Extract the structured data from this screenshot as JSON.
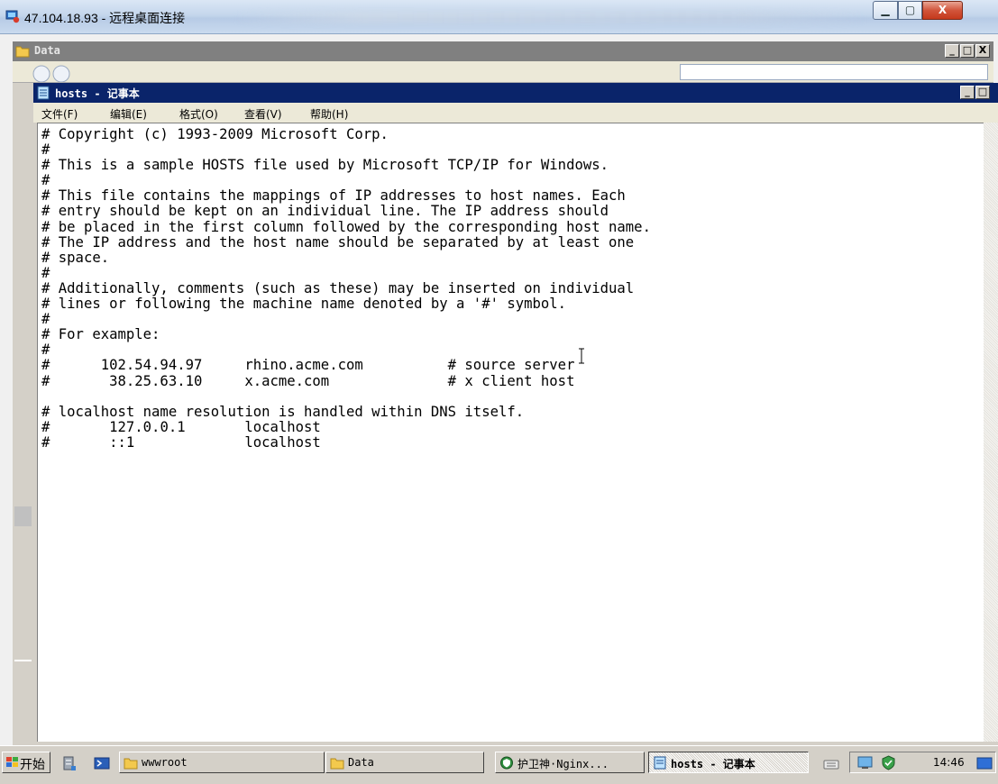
{
  "rdp": {
    "title": "47.104.18.93 - 远程桌面连接",
    "min_label": "▁",
    "max_label": "▢",
    "close_label": "X"
  },
  "data_window": {
    "title": "Data",
    "min_label": "_",
    "max_label": "□",
    "close_label": "X"
  },
  "notepad": {
    "title": "hosts - 记事本",
    "min_label": "_",
    "max_label": "□",
    "menu": [
      "文件(F)",
      "编辑(E)",
      "格式(O)",
      "查看(V)",
      "帮助(H)"
    ],
    "content": "# Copyright (c) 1993-2009 Microsoft Corp.\n#\n# This is a sample HOSTS file used by Microsoft TCP/IP for Windows.\n#\n# This file contains the mappings of IP addresses to host names. Each\n# entry should be kept on an individual line. The IP address should\n# be placed in the first column followed by the corresponding host name.\n# The IP address and the host name should be separated by at least one\n# space.\n#\n# Additionally, comments (such as these) may be inserted on individual\n# lines or following the machine name denoted by a '#' symbol.\n#\n# For example:\n#\n#      102.54.94.97     rhino.acme.com          # source server\n#       38.25.63.10     x.acme.com              # x client host\n\n# localhost name resolution is handled within DNS itself.\n#\t127.0.0.1       localhost\n#\t::1             localhost"
  },
  "taskbar": {
    "start_label": "开始",
    "items": [
      {
        "label": "wwwroot",
        "icon": "folder-icon",
        "active": false
      },
      {
        "label": "Data",
        "icon": "folder-icon",
        "active": false
      },
      {
        "label": "护卫神·Nginx...",
        "icon": "shield-icon",
        "active": false
      },
      {
        "label": "hosts - 记事本",
        "icon": "notepad-icon",
        "active": true
      }
    ],
    "clock": "14:46"
  },
  "colors": {
    "active_title": "#0a246a",
    "inactive_title": "#808080",
    "face": "#d4d0c8"
  }
}
